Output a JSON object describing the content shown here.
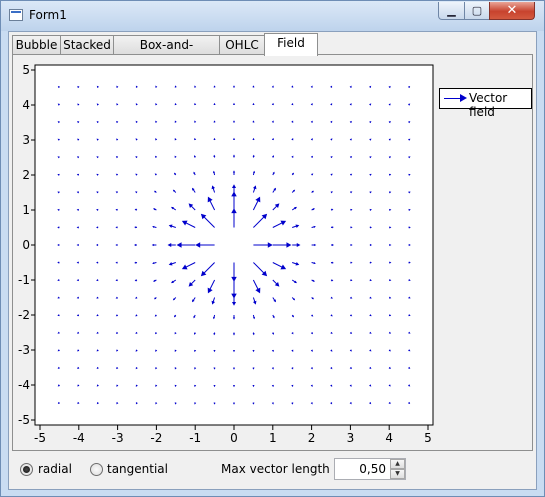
{
  "window": {
    "title": "Form1",
    "icons": {
      "app": "form-icon",
      "minimize": "minimize-icon",
      "maximize": "maximize-icon",
      "close": "close-icon"
    },
    "min_glyph": "▁",
    "max_glyph": "▢",
    "close_glyph": "✕"
  },
  "tabs": [
    {
      "label": "Bubble",
      "active": false
    },
    {
      "label": "Stacked",
      "active": false
    },
    {
      "label": "Box-and-whiskers",
      "active": false
    },
    {
      "label": "OHLC",
      "active": false
    },
    {
      "label": "Field",
      "active": true
    }
  ],
  "legend": {
    "label": "Vector field",
    "color": "#0000cc"
  },
  "chart_data": {
    "type": "scatter",
    "series": [
      {
        "name": "Vector field",
        "field": "radial",
        "max_vector_length": 0.5,
        "grid_step": 0.5,
        "color": "#0000cc"
      }
    ],
    "x_ticks": [
      "-5",
      "-4",
      "-3",
      "-2",
      "-1",
      "0",
      "1",
      "2",
      "3",
      "4",
      "5"
    ],
    "y_ticks": [
      "5",
      "4",
      "3",
      "2",
      "1",
      "0",
      "-1",
      "-2",
      "-3",
      "-4",
      "-5"
    ],
    "xlim": [
      -5,
      5
    ],
    "ylim": [
      -5,
      5
    ],
    "grid": false,
    "legend_position": "top-right"
  },
  "controls": {
    "radial_label": "radial",
    "tangential_label": "tangential",
    "selected_mode": "radial",
    "max_length_label": "Max vector length",
    "max_length_value": "0,50",
    "spin_up_icon": "arrow-up-icon",
    "spin_down_icon": "arrow-down-icon",
    "spin_up_glyph": "▲",
    "spin_down_glyph": "▼"
  }
}
